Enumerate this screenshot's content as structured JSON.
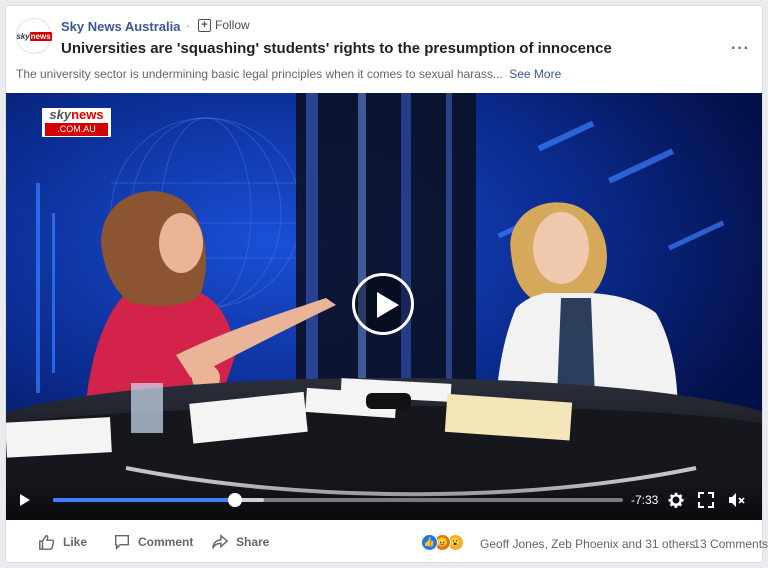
{
  "post": {
    "page_name": "Sky News Australia",
    "separator": "·",
    "follow_label": "Follow",
    "title": "Universities are 'squashing' students' rights to the presumption of innocence",
    "description": "The university sector is undermining basic legal principles when it comes to sexual harass...",
    "see_more": "See More",
    "more_icon": "ellipsis-icon",
    "avatar_logo": {
      "sky": "sky",
      "news": "news"
    }
  },
  "video": {
    "logo": {
      "top_sky": "sky",
      "top_news": "news",
      "bottom": ".COM.AU"
    },
    "time_remaining": "-7:33",
    "progress_fraction": 0.32,
    "buffer_fraction": 0.37,
    "icons": [
      "play-icon",
      "settings-gear-icon",
      "fullscreen-icon",
      "volume-muted-icon"
    ]
  },
  "actions": {
    "like": "Like",
    "comment": "Comment",
    "share": "Share"
  },
  "reactions": {
    "types": [
      "like",
      "angry",
      "wow"
    ],
    "summary": "Geoff Jones, Zeb Phoenix and 31 others",
    "separator": "·",
    "comments": "13 Comments"
  },
  "colors": {
    "link": "#385898",
    "progress": "#4080ff",
    "brand_red": "#d20000"
  }
}
